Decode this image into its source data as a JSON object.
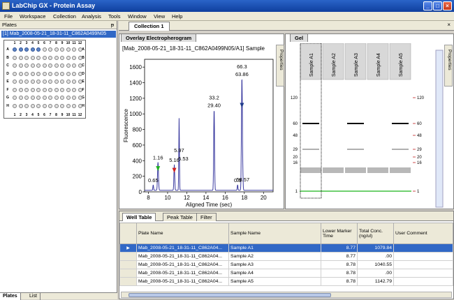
{
  "window": {
    "title": "LabChip GX - Protein Assay",
    "buttons": {
      "minimize": "_",
      "maximize": "□",
      "close": "×"
    }
  },
  "menu": [
    "File",
    "Workspace",
    "Collection",
    "Analysis",
    "Tools",
    "Window",
    "View",
    "Help"
  ],
  "tabs": {
    "collection": "Collection 1",
    "close": "×"
  },
  "plates_panel": {
    "title": "Plates",
    "pin": "ᵽ",
    "item": "[1] Mab_2008-05-21_18-31-11_C862A0499N05",
    "rows": [
      "A",
      "B",
      "C",
      "D",
      "E",
      "F",
      "G",
      "H"
    ],
    "cols": [
      "1",
      "2",
      "3",
      "4",
      "5",
      "6",
      "7",
      "8",
      "9",
      "10",
      "11",
      "12"
    ],
    "bottom_tabs": [
      "Plates",
      "List"
    ]
  },
  "overlay": {
    "tab": "Overlay Electropherogram",
    "title": "[Mab_2008-05-21_18-31-11_C862A0499N05/A1] Sample",
    "properties": "Properties"
  },
  "chart_data": {
    "type": "line",
    "xlabel": "Aligned Time (sec)",
    "ylabel": "Fluorescence",
    "xlim": [
      7.6,
      21
    ],
    "ylim": [
      0,
      1700
    ],
    "xticks": [
      "8",
      "10",
      "12",
      "14",
      "16",
      "18",
      "20"
    ],
    "yticks": [
      "0",
      "200",
      "400",
      "600",
      "800",
      "1000",
      "1200",
      "1400",
      "1600"
    ],
    "series": [
      {
        "color": "#3a3aa0",
        "peaks": [
          {
            "x": 8.5,
            "y": 70,
            "label": "0.65",
            "w": 0.05
          },
          {
            "x": 9.0,
            "y": 360,
            "label": "1.16",
            "w": 0.07
          },
          {
            "x": 10.7,
            "y": 330,
            "label": "5.16",
            "w": 0.06
          },
          {
            "x": 11.2,
            "y": 455,
            "label": "5.97",
            "w": 0.05
          },
          {
            "x": 11.2,
            "y": 470,
            "label": "5.53",
            "w": 0.04
          },
          {
            "x": 14.85,
            "y": 1040,
            "label": "33.2",
            "label2": "29.40",
            "w": 0.06
          },
          {
            "x": 17.3,
            "y": 70,
            "label": "0.5",
            "w": 0.05
          },
          {
            "x": 17.75,
            "y": 1440,
            "label": "66.3",
            "label2": "63.86",
            "w": 0.07
          },
          {
            "x": 17.85,
            "y": 80,
            "label": "58.57",
            "w": 0.05
          }
        ]
      }
    ],
    "markers": [
      {
        "x": 9.0,
        "color": "#20b020"
      },
      {
        "x": 10.7,
        "color": "#d02020"
      },
      {
        "x": 17.75,
        "color": "#203c8c"
      }
    ]
  },
  "gel": {
    "tab": "Gel",
    "properties": "Properties",
    "lanes": [
      "Sample A1",
      "Sample A2",
      "Sample A3",
      "Sample A4",
      "Sample A5"
    ],
    "ladder": [
      "120",
      "60",
      "48",
      "29",
      "20",
      "16",
      "1"
    ],
    "ladder_right": [
      "120",
      "60",
      "48",
      "29",
      "20",
      "16",
      "1"
    ]
  },
  "table": {
    "tabs": [
      "Well Table",
      "Peak Table",
      "Filter"
    ],
    "headers": [
      "Plate Name",
      "Sample Name",
      "Lower Marker Time",
      "Total Conc. (ng/ul)",
      "User Comment"
    ],
    "rows": [
      {
        "plate": "Mab_2008-05-21_18-31-11_C862A04...",
        "sample": "Sample A1",
        "lmt": "8.77",
        "conc": "1079.84"
      },
      {
        "plate": "Mab_2008-05-21_18-31-11_C862A04...",
        "sample": "Sample A2",
        "lmt": "8.77",
        "conc": ".00"
      },
      {
        "plate": "Mab_2008-05-21_18-31-11_C862A04...",
        "sample": "Sample A3",
        "lmt": "8.78",
        "conc": "1040.55"
      },
      {
        "plate": "Mab_2008-05-21_18-31-11_C862A04...",
        "sample": "Sample A4",
        "lmt": "8.78",
        "conc": ".00"
      },
      {
        "plate": "Mab_2008-05-21_18-31-11_C862A04...",
        "sample": "Sample A5",
        "lmt": "8.78",
        "conc": "1142.79"
      }
    ],
    "selected_row": 0,
    "row_indicator": "▶"
  }
}
